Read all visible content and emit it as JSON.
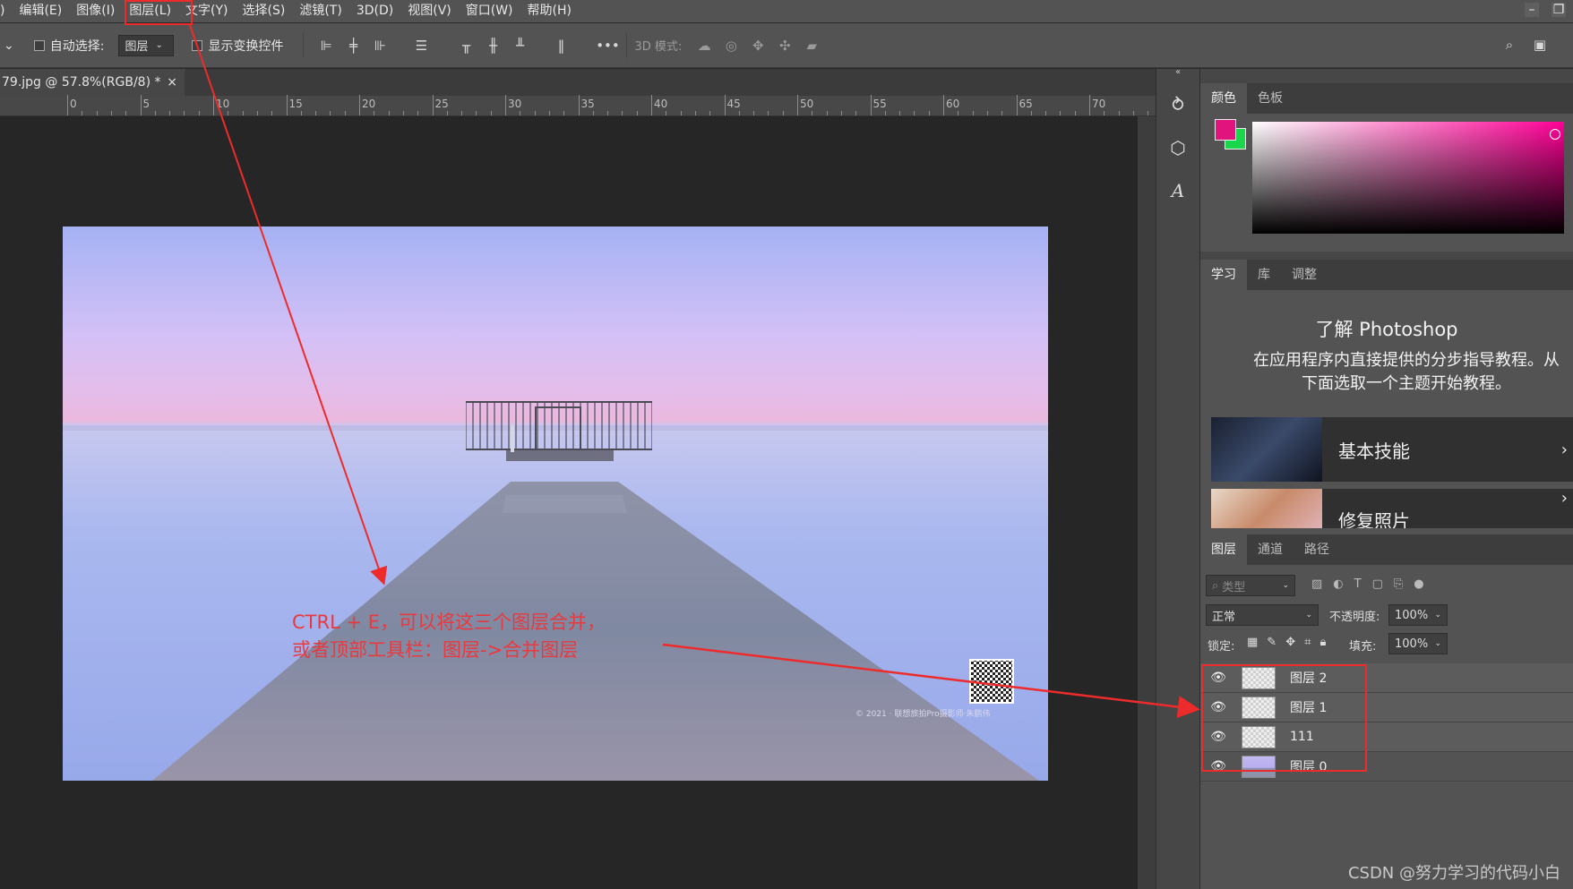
{
  "menu": {
    "items": [
      "编辑(E)",
      "图像(I)",
      "图层(L)",
      "文字(Y)",
      "选择(S)",
      "滤镜(T)",
      "3D(D)",
      "视图(V)",
      "窗口(W)",
      "帮助(H)"
    ]
  },
  "options_bar": {
    "auto_select_label": "自动选择:",
    "auto_select_value": "图层",
    "show_transform_label": "显示变换控件",
    "mode_3d_label": "3D 模式:"
  },
  "document_tab": {
    "title": "79.jpg @ 57.8%(RGB/8) *",
    "close": "×"
  },
  "ruler": {
    "labels": [
      "0",
      "5",
      "10",
      "15",
      "20",
      "25",
      "30",
      "35",
      "40",
      "45",
      "50",
      "55",
      "60",
      "65",
      "70"
    ]
  },
  "color_panel": {
    "tabs": [
      "颜色",
      "色板"
    ],
    "foreground_color": "#e0147c",
    "background_color": "#19d64b",
    "hue_color": "#ff0096"
  },
  "learn_panel": {
    "tabs": [
      "学习",
      "库",
      "调整"
    ],
    "title": "了解 Photoshop",
    "desc_line1": "在应用程序内直接提供的分步指导教程。从",
    "desc_line2": "下面选取一个主题开始教程。",
    "cards": [
      {
        "label": "基本技能"
      },
      {
        "label": "修复照片"
      }
    ]
  },
  "layers_panel": {
    "tabs": [
      "图层",
      "通道",
      "路径"
    ],
    "search_placeholder": "类型",
    "blend_mode": "正常",
    "opacity_label": "不透明度:",
    "opacity_value": "100%",
    "lock_label": "锁定:",
    "fill_label": "填充:",
    "fill_value": "100%",
    "layers": [
      {
        "name": "图层 2"
      },
      {
        "name": "图层 1"
      },
      {
        "name": "111"
      },
      {
        "name": "图层 0"
      }
    ]
  },
  "annotation": {
    "line1": "CTRL + E，可以将这三个图层合并，",
    "line2": "或者顶部工具栏：图层->合并图层",
    "accent_color": "#ee2b2b"
  },
  "image_caption": "© 2021 · 联想旅拍Pro摄影师·朱鹏伟",
  "watermark": "CSDN @努力学习的代码小白"
}
